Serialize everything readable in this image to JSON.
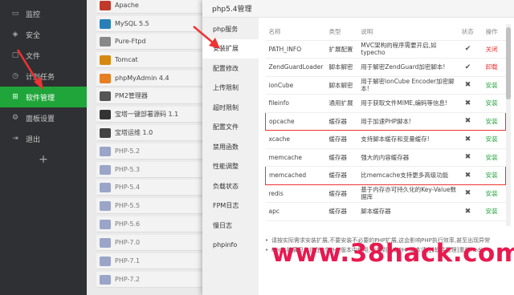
{
  "sidebar": {
    "items": [
      {
        "label": "监控",
        "icon": "monitor-icon"
      },
      {
        "label": "安全",
        "icon": "shield-icon"
      },
      {
        "label": "文件",
        "icon": "folder-icon"
      },
      {
        "label": "计划任务",
        "icon": "clock-icon"
      },
      {
        "label": "软件管理",
        "icon": "grid-icon",
        "active": true
      },
      {
        "label": "面板设置",
        "icon": "settings-icon"
      },
      {
        "label": "退出",
        "icon": "logout-icon"
      }
    ],
    "add_label": "+"
  },
  "software_list": [
    "Apache",
    "MySQL 5.5",
    "Pure-Ftpd",
    "Tomcat",
    "phpMyAdmin 4.4",
    "PM2管理器",
    "宝塔一键部署源码 1.1",
    "宝塔运维 1.0",
    "PHP-5.2",
    "PHP-5.3",
    "PHP-5.4",
    "PHP-5.5",
    "PHP-5.6",
    "PHP-7.0",
    "PHP-7.1",
    "PHP-7.2"
  ],
  "modal": {
    "title": "php5.4管理",
    "tabs": [
      "php服务",
      "安装扩展",
      "配置修改",
      "上传限制",
      "超时限制",
      "配置文件",
      "禁用函数",
      "性能调整",
      "负载状态",
      "FPM日志",
      "慢日志",
      "phpinfo"
    ],
    "active_tab": "安装扩展",
    "table": {
      "headers": [
        "名称",
        "类型",
        "说明",
        "状态",
        "操作"
      ],
      "rows": [
        {
          "name": "PATH_INFO",
          "type": "扩展配置",
          "desc": "MVC架构的程序需要开启,如typecho",
          "status": "✔",
          "op": "关闭",
          "op_color": "red",
          "highlight": false
        },
        {
          "name": "ZendGuardLoader",
          "type": "脚本解密",
          "desc": "用于解密ZendGuard加密脚本!",
          "status": "✔",
          "op": "卸载",
          "op_color": "red",
          "highlight": false
        },
        {
          "name": "ionCube",
          "type": "脚本解密",
          "desc": "用于解密ionCube Encoder加密脚本!",
          "status": "✖",
          "op": "安装",
          "op_color": "green",
          "highlight": false
        },
        {
          "name": "fileinfo",
          "type": "通用扩展",
          "desc": "用于获取文件MIME,编码等信息!",
          "status": "✖",
          "op": "安装",
          "op_color": "green",
          "highlight": false
        },
        {
          "name": "opcache",
          "type": "缓存器",
          "desc": "用于加速PHP脚本!",
          "status": "✖",
          "op": "安装",
          "op_color": "green",
          "highlight": true
        },
        {
          "name": "xcache",
          "type": "缓存器",
          "desc": "支持脚本缓存和变量缓存!",
          "status": "✖",
          "op": "安装",
          "op_color": "green",
          "highlight": false
        },
        {
          "name": "memcache",
          "type": "缓存器",
          "desc": "强大的内容缓存器",
          "status": "✖",
          "op": "安装",
          "op_color": "green",
          "highlight": false
        },
        {
          "name": "memcached",
          "type": "缓存器",
          "desc": "比memcache支持更多高级功能",
          "status": "✖",
          "op": "安装",
          "op_color": "green",
          "highlight": true
        },
        {
          "name": "redis",
          "type": "缓存器",
          "desc": "基于内存亦可持久化的Key-Value数据库",
          "status": "✖",
          "op": "安装",
          "op_color": "green",
          "highlight": false
        },
        {
          "name": "apc",
          "type": "缓存器",
          "desc": "脚本缓存器",
          "status": "✖",
          "op": "安装",
          "op_color": "green",
          "highlight": false
        }
      ]
    },
    "notes": [
      "请按实际需求安装扩展,不要安装不必要的PHP扩展,这会影响PHP执行效率,甚至出现异常",
      "Redis扩展只允许在1个PHP版本中使用,安装到其它PHP版本请在[软件管理]重装Redis"
    ]
  },
  "watermark": "www.38hack.com",
  "colors": {
    "accent": "#20a53a",
    "highlight": "#e33333",
    "watermark": "#e8194f",
    "sidebar_bg": "#2f3033"
  }
}
